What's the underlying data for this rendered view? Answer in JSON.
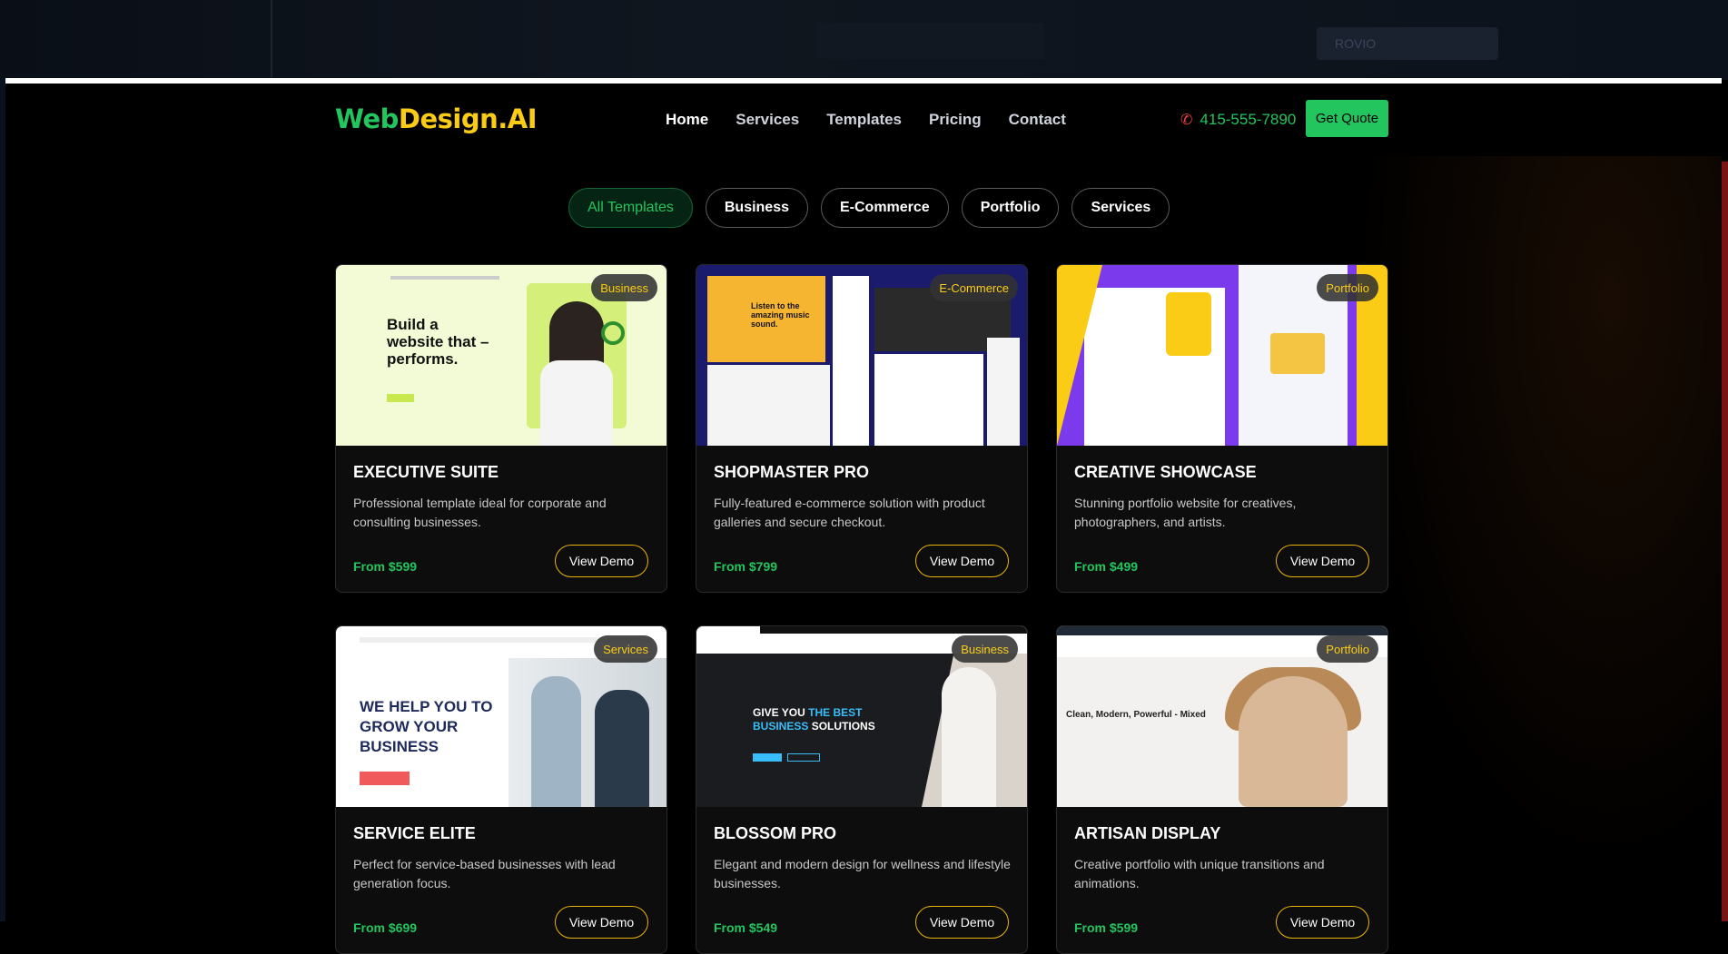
{
  "backdrop": {
    "ghost_label": "ROVIO"
  },
  "logo": {
    "part1": "Web",
    "part2": "Design.AI"
  },
  "nav": {
    "items": [
      "Home",
      "Services",
      "Templates",
      "Pricing",
      "Contact"
    ],
    "active": "Home",
    "phone": "415-555-7890",
    "cta": "Get Quote"
  },
  "filters": {
    "items": [
      "All Templates",
      "Business",
      "E-Commerce",
      "Portfolio",
      "Services"
    ],
    "active": "All Templates"
  },
  "cards": [
    {
      "badge": "Business",
      "title": "EXECUTIVE SUITE",
      "desc": "Professional template ideal for corporate and consulting businesses.",
      "price": "From $599",
      "button": "View Demo",
      "thumb_text": "Build a website that – performs."
    },
    {
      "badge": "E-Commerce",
      "title": "SHOPMASTER PRO",
      "desc": "Fully-featured e-commerce solution with product galleries and secure checkout.",
      "price": "From $799",
      "button": "View Demo",
      "thumb_text": "Listen to the amazing music sound."
    },
    {
      "badge": "Portfolio",
      "title": "CREATIVE SHOWCASE",
      "desc": "Stunning portfolio website for creatives, photographers, and artists.",
      "price": "From $499",
      "button": "View Demo",
      "thumb_text": ""
    },
    {
      "badge": "Services",
      "title": "SERVICE ELITE",
      "desc": "Perfect for service-based businesses with lead generation focus.",
      "price": "From $699",
      "button": "View Demo",
      "thumb_text": "WE HELP YOU TO GROW YOUR BUSINESS"
    },
    {
      "badge": "Business",
      "title": "BLOSSOM PRO",
      "desc": "Elegant and modern design for wellness and lifestyle businesses.",
      "price": "From $549",
      "button": "View Demo",
      "thumb_text_a": "GIVE YOU",
      "thumb_text_b": "THE BEST",
      "thumb_text_c": "BUSINESS",
      "thumb_text_d": "SOLUTIONS"
    },
    {
      "badge": "Portfolio",
      "title": "ARTISAN DISPLAY",
      "desc": "Creative portfolio with unique transitions and animations.",
      "price": "From $599",
      "button": "View Demo",
      "thumb_text": "Clean, Modern, Powerful - Mixed"
    }
  ],
  "colors": {
    "green": "#22c55e",
    "yellow": "#facc15",
    "red": "#ef4444"
  }
}
